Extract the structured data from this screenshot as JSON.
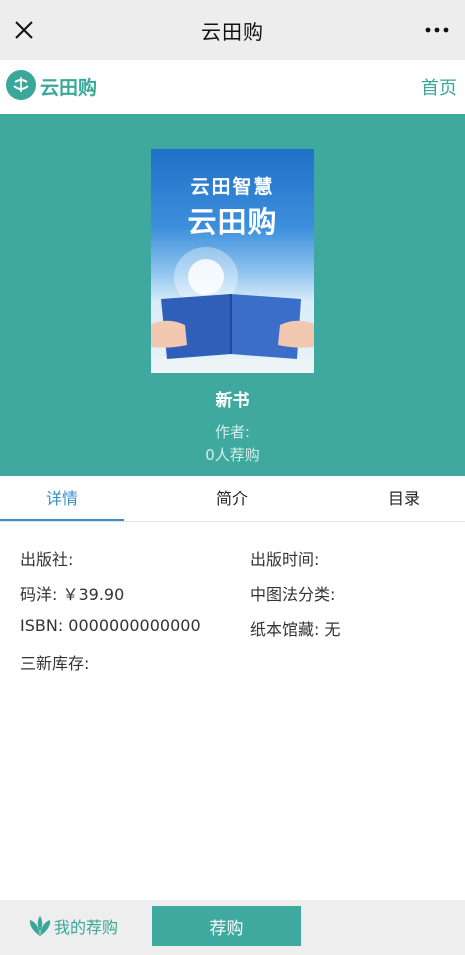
{
  "window": {
    "title": "云田购"
  },
  "header": {
    "logo_text": "云田购",
    "home_label": "首页"
  },
  "book": {
    "cover_line1": "云田智慧",
    "cover_line2": "云田购",
    "title": "新书",
    "author": "作者:",
    "recommend_count": "0人荐购"
  },
  "tabs": [
    {
      "label": "详情",
      "active": true
    },
    {
      "label": "简介",
      "active": false
    },
    {
      "label": "目录",
      "active": false
    }
  ],
  "details": {
    "publisher": "出版社:",
    "publish_time": "出版时间:",
    "price": "码洋: ￥39.90",
    "clc": "中图法分类:",
    "isbn": "ISBN: 0000000000000",
    "paper_holding": "纸本馆藏: 无",
    "stock": "三新库存:"
  },
  "bottom": {
    "my_recommend": "我的荐购",
    "recommend_button": "荐购"
  },
  "colors": {
    "accent": "#3fa9a0",
    "tab_active": "#3a8ec9"
  }
}
